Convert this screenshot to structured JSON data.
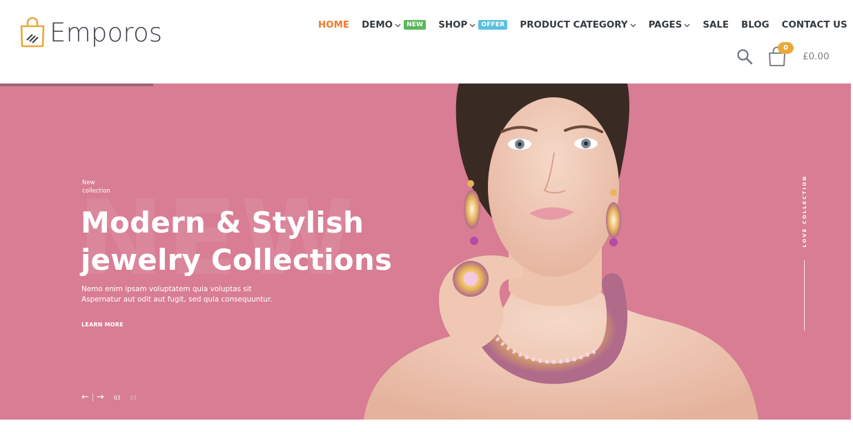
{
  "brand": {
    "name": "Emporos"
  },
  "nav": {
    "items": [
      {
        "label": "HOME",
        "active": true,
        "dropdown": false
      },
      {
        "label": "DEMO",
        "active": false,
        "dropdown": true,
        "badge": "NEW"
      },
      {
        "label": "SHOP",
        "active": false,
        "dropdown": true,
        "badge": "OFFER"
      },
      {
        "label": "PRODUCT CATEGORY",
        "active": false,
        "dropdown": true
      },
      {
        "label": "PAGES",
        "active": false,
        "dropdown": true
      },
      {
        "label": "SALE",
        "active": false,
        "dropdown": false
      },
      {
        "label": "BLOG",
        "active": false,
        "dropdown": false
      },
      {
        "label": "CONTACT US",
        "active": false,
        "dropdown": false
      }
    ]
  },
  "header_tools": {
    "search_icon": "search-icon",
    "cart_icon": "shopping-bag-icon",
    "cart_count": "0",
    "cart_total": "£0.00"
  },
  "hero": {
    "eyebrow": "New collection",
    "background_word": "NEW",
    "title_line1": "Modern & Stylish",
    "title_line2": "jewelry Collections",
    "description": "Nemo enim ipsam voluptatem quia voluptas sit Aspernatur aut odit aut fugit, sed quia consequuntur.",
    "link_label": "LEARN MORE",
    "prev_arrow": "←",
    "next_arrow": "→",
    "slide_current": "03",
    "slide_total": "03",
    "side_label": "LOVE COLLECTION"
  },
  "colors": {
    "accent": "#ee7a2b",
    "hero_background": "#d87d93",
    "badge_new": "#5bb75b",
    "badge_offer": "#5bc0de",
    "cart_badge": "#e9a93a"
  }
}
